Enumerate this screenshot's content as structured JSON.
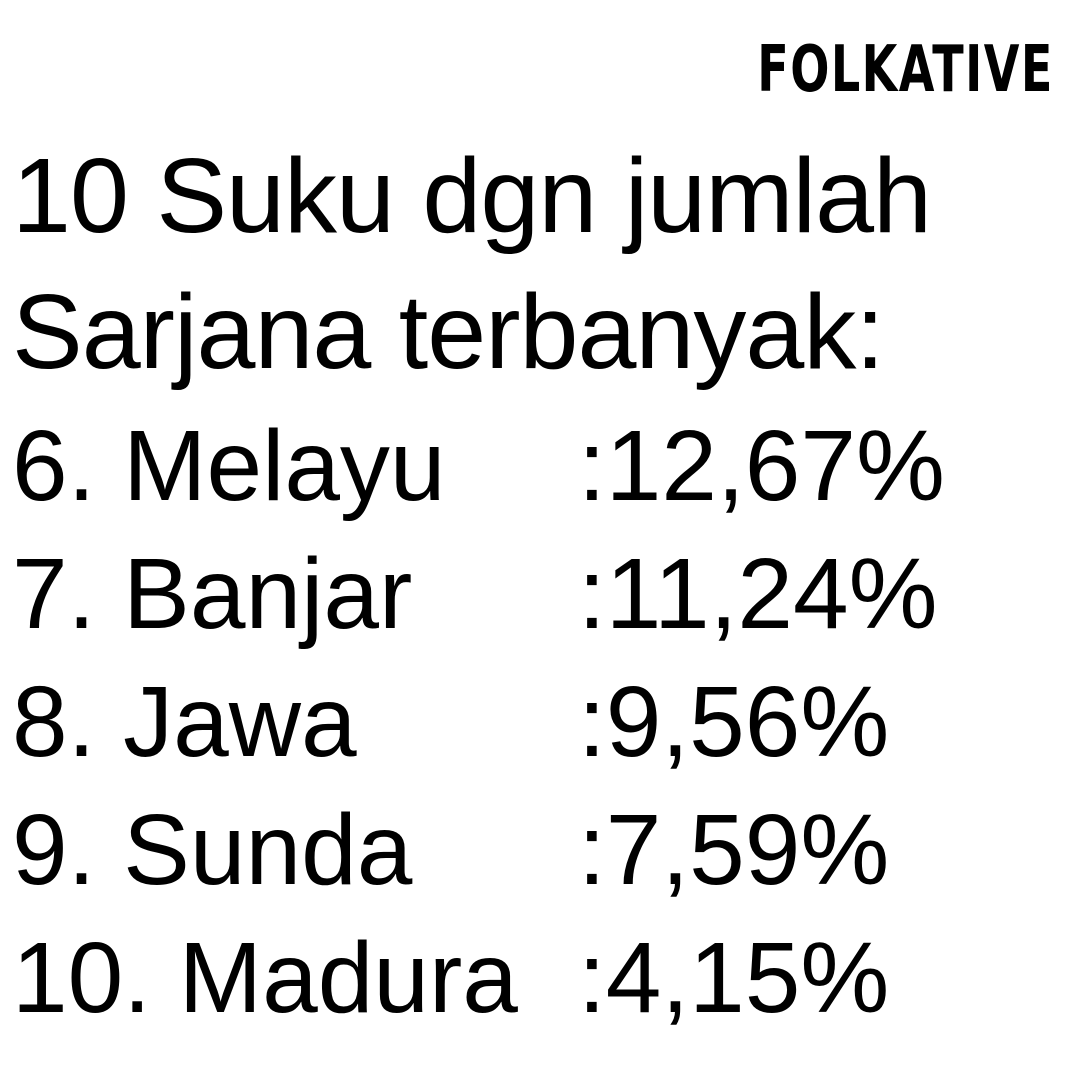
{
  "brand": "FOLKATIVE",
  "title": {
    "line1": "10 Suku dgn jumlah",
    "line2": "Sarjana terbanyak:"
  },
  "items": [
    {
      "label": "6. Melayu",
      "value": ":12,67%"
    },
    {
      "label": "7. Banjar",
      "value": ":11,24%"
    },
    {
      "label": "8. Jawa",
      "value": ":9,56%"
    },
    {
      "label": "9. Sunda",
      "value": ":7,59%"
    },
    {
      "label": "10. Madura",
      "value": ":4,15%"
    }
  ]
}
